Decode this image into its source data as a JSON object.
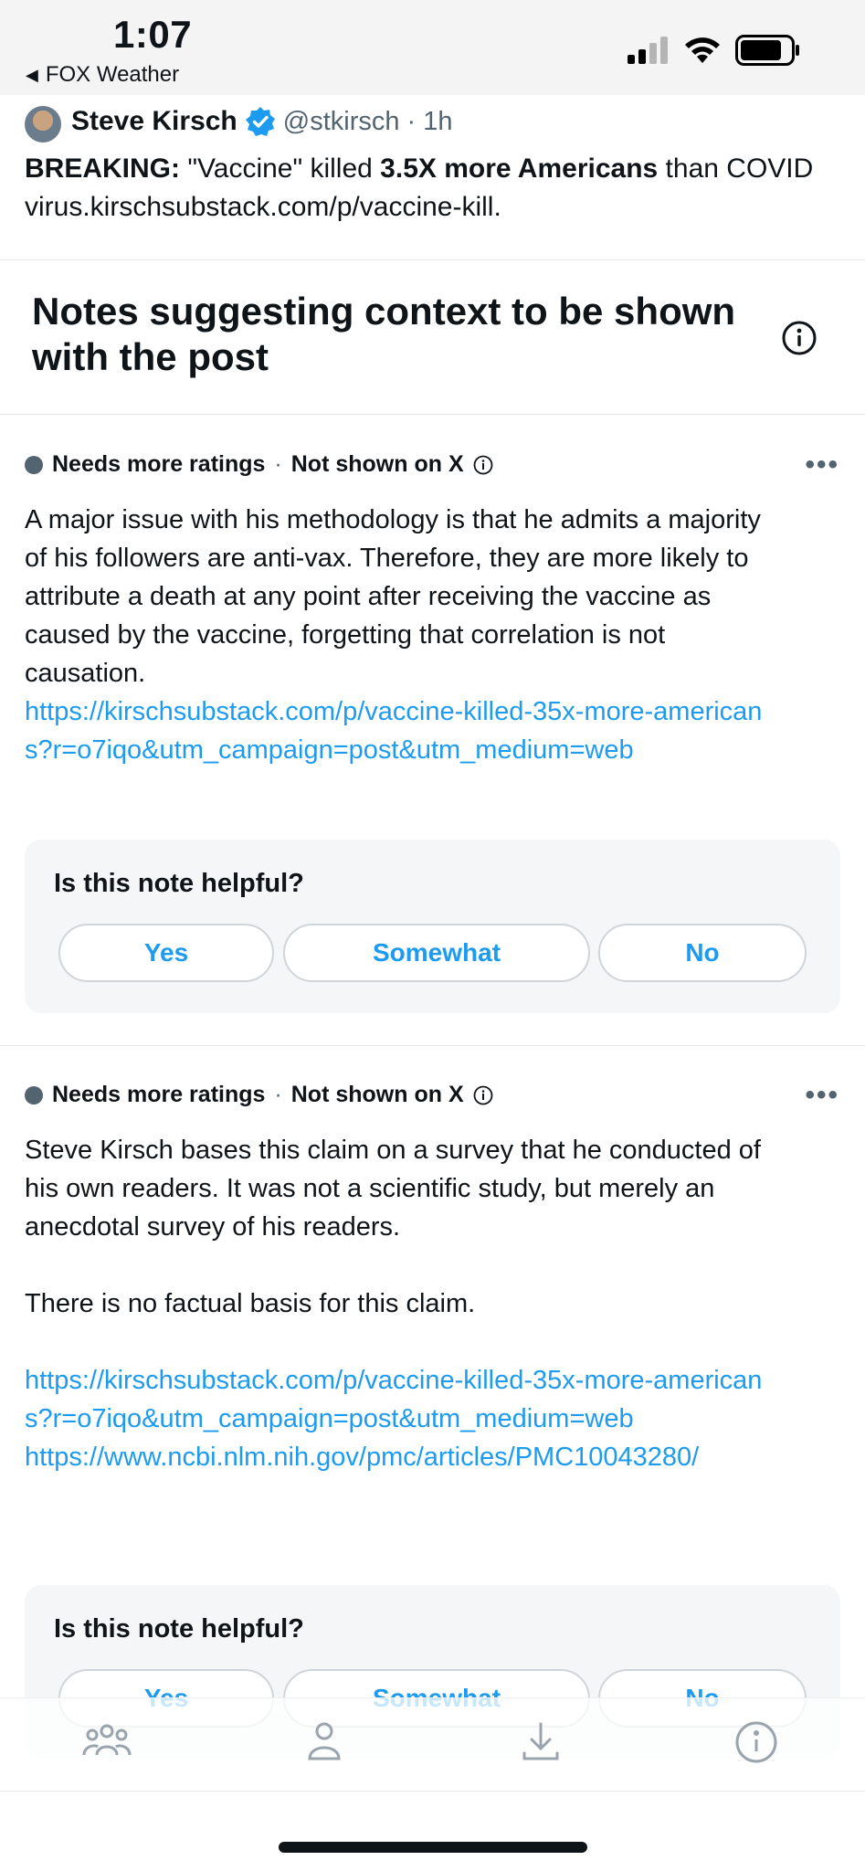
{
  "status_bar": {
    "time": "1:07",
    "back_label": "FOX Weather"
  },
  "post": {
    "author": "Steve Kirsch",
    "handle": "@stkirsch · 1h",
    "text_bold_1": "BREAKING:",
    "text_1": " \"Vaccine\" killed ",
    "text_bold_2": "3.5X more Americans",
    "text_2": " than COVID virus.kirschsubstack.com/p/vaccine-kill."
  },
  "notes_section": {
    "title": "Notes suggesting context to be shown with the post"
  },
  "notes": [
    {
      "status": "Needs more ratings",
      "separator": "·",
      "visibility": "Not shown on X",
      "more_label": "•••",
      "body": "A major issue with his methodology is that he admits a majority of his followers are anti-vax. Therefore, they are more likely to attribute a death at any point after receiving the vaccine as caused by the vaccine, forgetting that correlation is not causation.",
      "link_1": "https://kirschsubstack.com/p/vaccine-killed-35x-more-americans?r=o7iqo&utm_campaign=post&utm_medium=web",
      "helpful_prompt": "Is this note helpful?",
      "buttons": [
        "Yes",
        "Somewhat",
        "No"
      ]
    },
    {
      "status": "Needs more ratings",
      "separator": "·",
      "visibility": "Not shown on X",
      "more_label": "•••",
      "body": "Steve Kirsch bases this claim on a survey that he conducted of his own readers. It was not a scientific study, but merely an anecdotal survey of his readers.",
      "body_2": "There is no factual basis for this claim.",
      "link_1": "https://kirschsubstack.com/p/vaccine-killed-35x-more-americans?r=o7iqo&utm_campaign=post&utm_medium=web",
      "link_2": "https://www.ncbi.nlm.nih.gov/pmc/articles/PMC10043280/",
      "helpful_prompt": "Is this note helpful?",
      "buttons": [
        "Yes",
        "Somewhat",
        "No"
      ]
    }
  ],
  "tab_bar": {
    "icons": [
      "community-icon",
      "profile-icon",
      "download-icon",
      "info-icon"
    ]
  },
  "colors": {
    "link": "#1d9bf0",
    "verified": "#1d9bf0",
    "muted": "#536471",
    "panel": "#f4f6f8"
  }
}
